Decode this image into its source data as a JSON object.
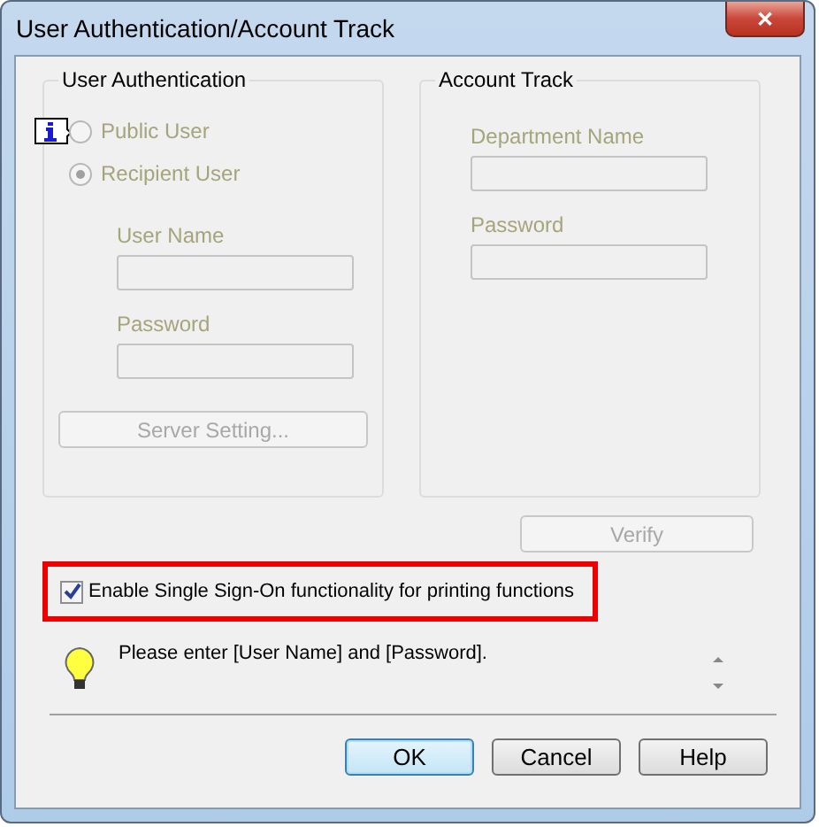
{
  "window": {
    "title": "User Authentication/Account Track",
    "close": "✕"
  },
  "user_authentication": {
    "title": "User Authentication",
    "radios": [
      {
        "label": "Public User",
        "selected": false,
        "disabled": true,
        "info": true
      },
      {
        "label": "Recipient User",
        "selected": true,
        "disabled": true,
        "info": false
      }
    ],
    "fields": [
      {
        "label": "User Name",
        "disabled": true
      },
      {
        "label": "Password",
        "disabled": true
      }
    ],
    "button": {
      "label": "Server Setting...",
      "disabled": true
    }
  },
  "account_track": {
    "title": "Account Track",
    "fields": [
      {
        "label": "Department Name",
        "disabled": true
      },
      {
        "label": "Password",
        "disabled": true
      }
    ]
  },
  "verify_button": {
    "label": "Verify",
    "disabled": true
  },
  "sso_checkbox": {
    "label": "Enable Single Sign-On functionality for printing functions",
    "checked": true,
    "highlighted": true
  },
  "message": {
    "text": "Please enter [User Name] and [Password]."
  },
  "buttons": [
    {
      "label": "OK",
      "default": true
    },
    {
      "label": "Cancel",
      "default": false
    },
    {
      "label": "Help",
      "default": false
    }
  ]
}
